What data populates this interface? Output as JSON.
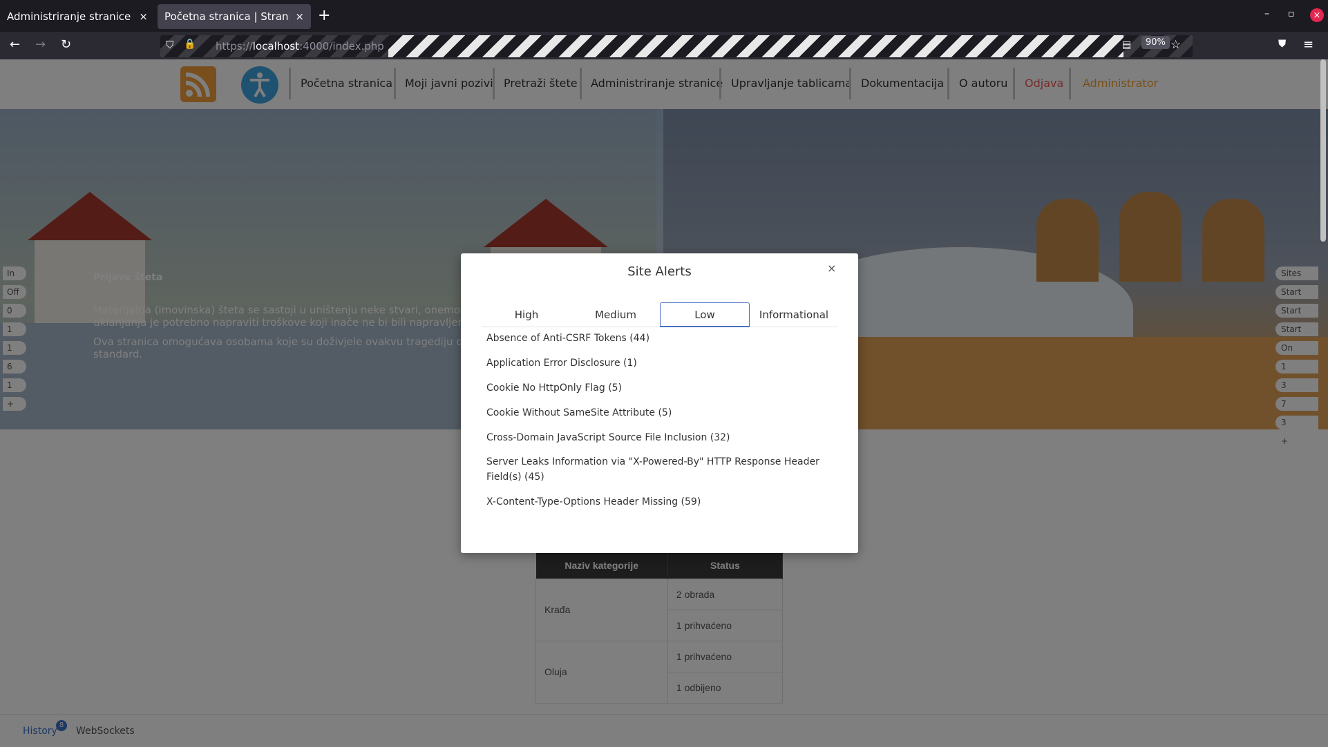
{
  "browser": {
    "tabs": [
      {
        "label": "Administriranje stranice | Str",
        "close": "×"
      },
      {
        "label": "Početna stranica | Stranica za",
        "close": "×"
      }
    ],
    "new_tab": "+",
    "window": {
      "minimize": "–",
      "restore": "▫",
      "close": "×"
    },
    "url_scheme": "https://",
    "url_host": "localhost",
    "url_rest": ":4000/index.php",
    "zoom": "90%"
  },
  "site": {
    "nav": [
      "Početna stranica",
      "Moji javni pozivi",
      "Pretraži štete",
      "Administriranje stranice",
      "Upravljanje tablicama",
      "Dokumentacija",
      "O autoru",
      "Odjava",
      "Administrator"
    ],
    "hero": {
      "title": "Prijave šteta",
      "p1": "Materijalna (imovinska) šteta se sastoji u uništenju neke stvari, onemogu uklanjanja je potrebno napraviti troškove koji inače ne bi bili napravljeni.",
      "p2": "Ova stranica omogućava osobama koje su doživjele ovakvu tragediju da standard."
    },
    "table": {
      "headers": [
        "Naziv kategorije",
        "Status"
      ],
      "rows": [
        {
          "category": "Krađa",
          "statuses": [
            "2 obrada",
            "1 prihvaćeno"
          ]
        },
        {
          "category": "Oluja",
          "statuses": [
            "1 prihvaćeno",
            "1 odbijeno"
          ]
        }
      ]
    }
  },
  "zap_hud": {
    "left": [
      "In",
      "Off",
      "0",
      "1",
      "1",
      "6",
      "1",
      "+"
    ],
    "right": [
      "Sites",
      "Start",
      "Start",
      "Start",
      "On",
      "1",
      "3",
      "7",
      "3",
      "+"
    ],
    "bottom_tabs": {
      "history": "History",
      "history_count": "8",
      "websockets": "WebSockets"
    }
  },
  "modal": {
    "title": "Site Alerts",
    "close": "×",
    "tabs": [
      "High",
      "Medium",
      "Low",
      "Informational"
    ],
    "active_tab": "Low",
    "alerts": [
      "Absence of Anti-CSRF Tokens (44)",
      "Application Error Disclosure (1)",
      "Cookie No HttpOnly Flag (5)",
      "Cookie Without SameSite Attribute (5)",
      "Cross-Domain JavaScript Source File Inclusion (32)",
      "Server Leaks Information via \"X-Powered-By\" HTTP Response Header Field(s) (45)",
      "X-Content-Type-Options Header Missing (59)"
    ]
  },
  "colors": {
    "accent": "#4a72c4",
    "logout": "#e55555",
    "admin": "#f0a030"
  }
}
